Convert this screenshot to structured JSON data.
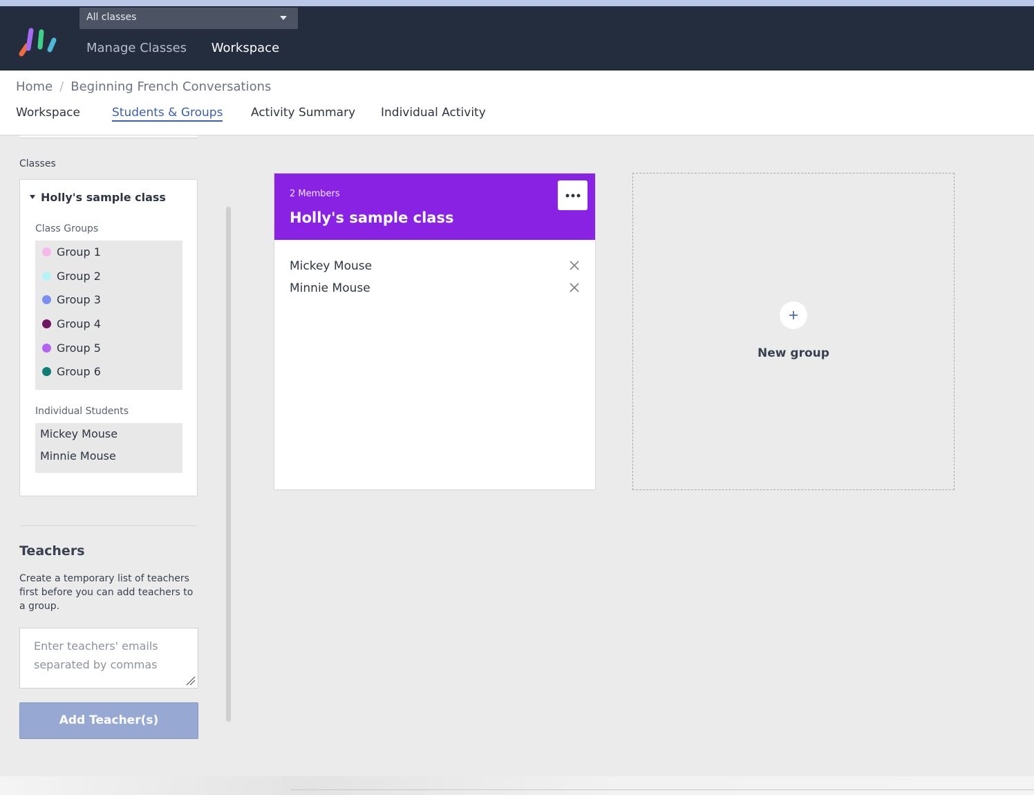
{
  "topbar": {
    "class_select": "All classes",
    "nav": [
      "Manage Classes",
      "Workspace"
    ],
    "colors": {
      "background": "#242d3e",
      "logo": [
        "#f26b3a",
        "#a56bf2",
        "#3fd08a",
        "#4fb8d8"
      ]
    }
  },
  "breadcrumb": {
    "home": "Home",
    "separator": "/",
    "current": "Beginning French Conversations"
  },
  "tabs": [
    "Workspace",
    "Students & Groups",
    "Activity Summary",
    "Individual Activity"
  ],
  "sidebar": {
    "classes_label": "Classes",
    "class_name": "Holly's sample class",
    "class_groups_label": "Class Groups",
    "groups": [
      {
        "label": "Group 1",
        "color": "#f9b8ec"
      },
      {
        "label": "Group 2",
        "color": "#b5f3f7"
      },
      {
        "label": "Group 3",
        "color": "#7b8ff0"
      },
      {
        "label": "Group 4",
        "color": "#6e1463"
      },
      {
        "label": "Group 5",
        "color": "#b365ef"
      },
      {
        "label": "Group 6",
        "color": "#0f7d74"
      }
    ],
    "individual_students_label": "Individual Students",
    "students": [
      "Mickey Mouse",
      "Minnie Mouse"
    ],
    "teachers_title": "Teachers",
    "teachers_desc": "Create a temporary list of teachers first before you can add teachers to a group.",
    "teachers_placeholder": "Enter teachers' emails separated by commas",
    "add_button": "Add Teacher(s)"
  },
  "group_card": {
    "members_count": "2 Members",
    "title": "Holly's sample class",
    "header_color": "#8a22e3",
    "members": [
      "Mickey Mouse",
      "Minnie Mouse"
    ]
  },
  "new_group": {
    "label": "New group",
    "icon": "plus-icon"
  }
}
